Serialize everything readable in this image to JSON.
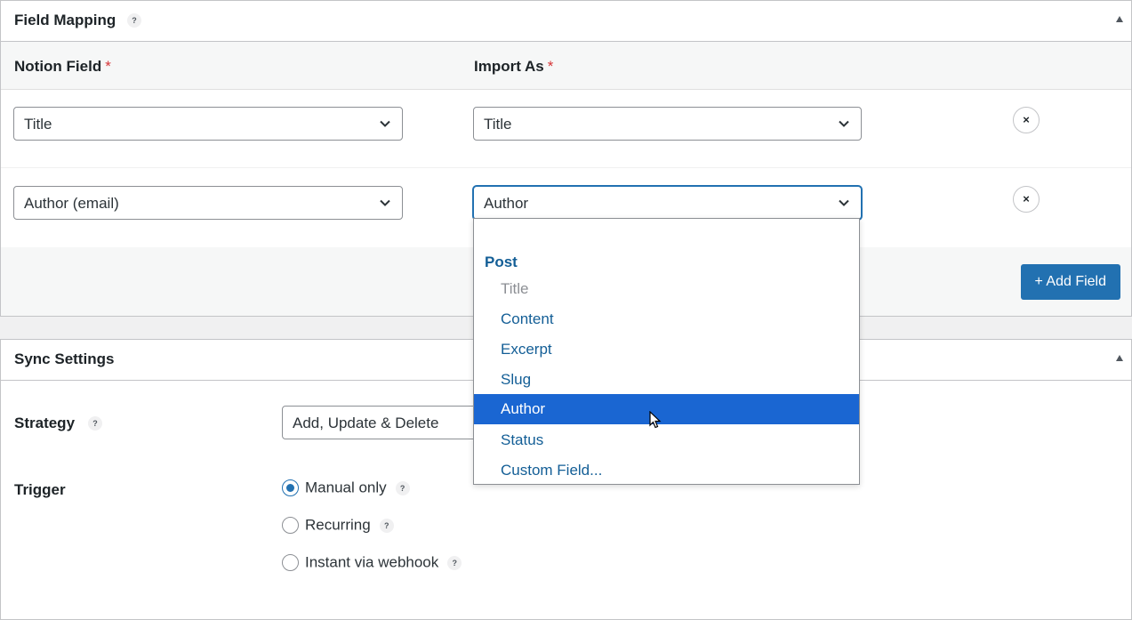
{
  "field_mapping": {
    "title": "Field Mapping",
    "help": "?",
    "col_notion": "Notion Field",
    "col_import": "Import As",
    "required_mark": "*",
    "rows": [
      {
        "notion_field": "Title",
        "import_as": "Title",
        "remove": "×"
      },
      {
        "notion_field": "Author (email)",
        "import_as": "Author",
        "remove": "×"
      }
    ],
    "add_field_label": "+ Add Field"
  },
  "dropdown": {
    "group_label": "Post",
    "options": [
      {
        "label": "Title",
        "state": "disabled"
      },
      {
        "label": "Content",
        "state": "normal"
      },
      {
        "label": "Excerpt",
        "state": "normal"
      },
      {
        "label": "Slug",
        "state": "normal"
      },
      {
        "label": "Author",
        "state": "selected"
      },
      {
        "label": "Status",
        "state": "normal"
      },
      {
        "label": "Custom Field...",
        "state": "normal"
      }
    ]
  },
  "sync_settings": {
    "title": "Sync Settings",
    "strategy_label": "Strategy",
    "strategy_value": "Add, Update & Delete",
    "help": "?",
    "trigger_label": "Trigger",
    "trigger_options": [
      {
        "label": "Manual only",
        "checked": true
      },
      {
        "label": "Recurring",
        "checked": false
      },
      {
        "label": "Instant via webhook",
        "checked": false
      }
    ]
  },
  "colors": {
    "primary": "#2271b1",
    "selected_option": "#1a66d2",
    "required": "#d63638",
    "option_text": "#135e96"
  }
}
